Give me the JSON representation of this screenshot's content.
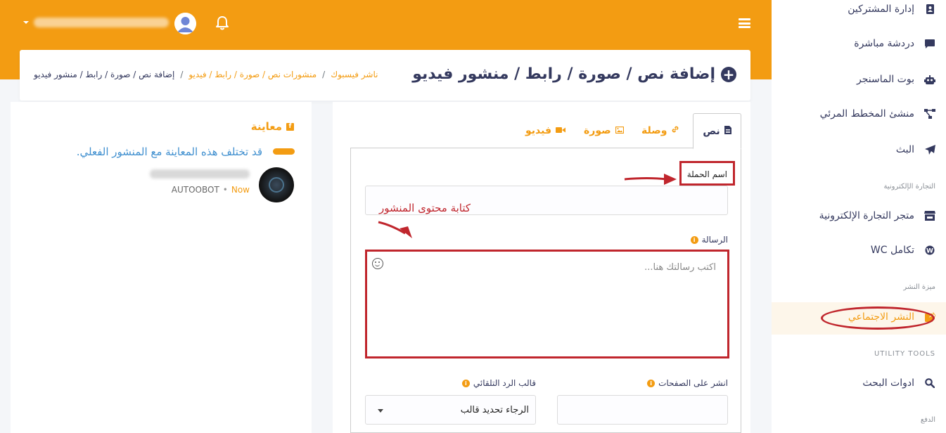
{
  "topbar": {
    "user_name_blurred": "",
    "bg_color": "#f39c12"
  },
  "header": {
    "title": "إضافة نص / صورة / رابط / منشور فيديو",
    "breadcrumb": [
      {
        "label": "ناشر فيسبوك",
        "active": false
      },
      {
        "label": "منشورات نص / صورة / رابط / فيديو",
        "active": false
      },
      {
        "label": "إضافة نص / صورة / رابط / منشور فيديو",
        "active": true
      }
    ],
    "separator": "/"
  },
  "preview": {
    "title": "معاينة",
    "warning": "قد تختلف هذه المعاينة مع المنشور الفعلي.",
    "time": "Now",
    "source": "AUTOOBOT"
  },
  "tabs": [
    {
      "label": "نص",
      "icon": "file-text-icon",
      "active": true
    },
    {
      "label": "وصلة",
      "icon": "link-icon",
      "active": false
    },
    {
      "label": "صورة",
      "icon": "image-icon",
      "active": false
    },
    {
      "label": "فيديو",
      "icon": "video-icon",
      "active": false
    }
  ],
  "form": {
    "campaign_name_label": "اسم الحملة",
    "campaign_name_value": "",
    "message_label": "الرسالة",
    "message_placeholder": "اكتب رسالتك هنا...",
    "pages_label": "انشر على الصفحات",
    "auto_reply_label": "قالب الرد التلقائي",
    "auto_reply_selected": "الرجاء تحديد قالب"
  },
  "annotations": {
    "content_note": "كتابة محتوى المنشور",
    "color": "#c0262d"
  },
  "sidebar": {
    "items_top": [
      {
        "label": "إدارة المشتركين",
        "icon": "address-book-icon"
      },
      {
        "label": "دردشة مباشرة",
        "icon": "chat-bubble-icon"
      },
      {
        "label": "بوت الماسنجر",
        "icon": "robot-icon"
      },
      {
        "label": "منشئ المخطط المرئي",
        "icon": "flow-diagram-icon"
      },
      {
        "label": "البث",
        "icon": "paper-plane-icon"
      }
    ],
    "section_ecommerce": "التجارة الإلكترونية",
    "items_ecommerce": [
      {
        "label": "متجر التجارة الإلكترونية",
        "icon": "store-icon"
      },
      {
        "label": "تكامل WC",
        "icon": "wordpress-icon"
      }
    ],
    "section_publishing": "ميزة النشر",
    "items_publishing": [
      {
        "label": "النشر الاجتماعي",
        "icon": "share-square-icon",
        "active": true
      }
    ],
    "section_utility": "UTILITY TOOLS",
    "items_utility": [
      {
        "label": "ادوات البحث",
        "icon": "search-icon"
      }
    ],
    "section_payment": "الدفع",
    "accent_color": "#f39c12"
  }
}
